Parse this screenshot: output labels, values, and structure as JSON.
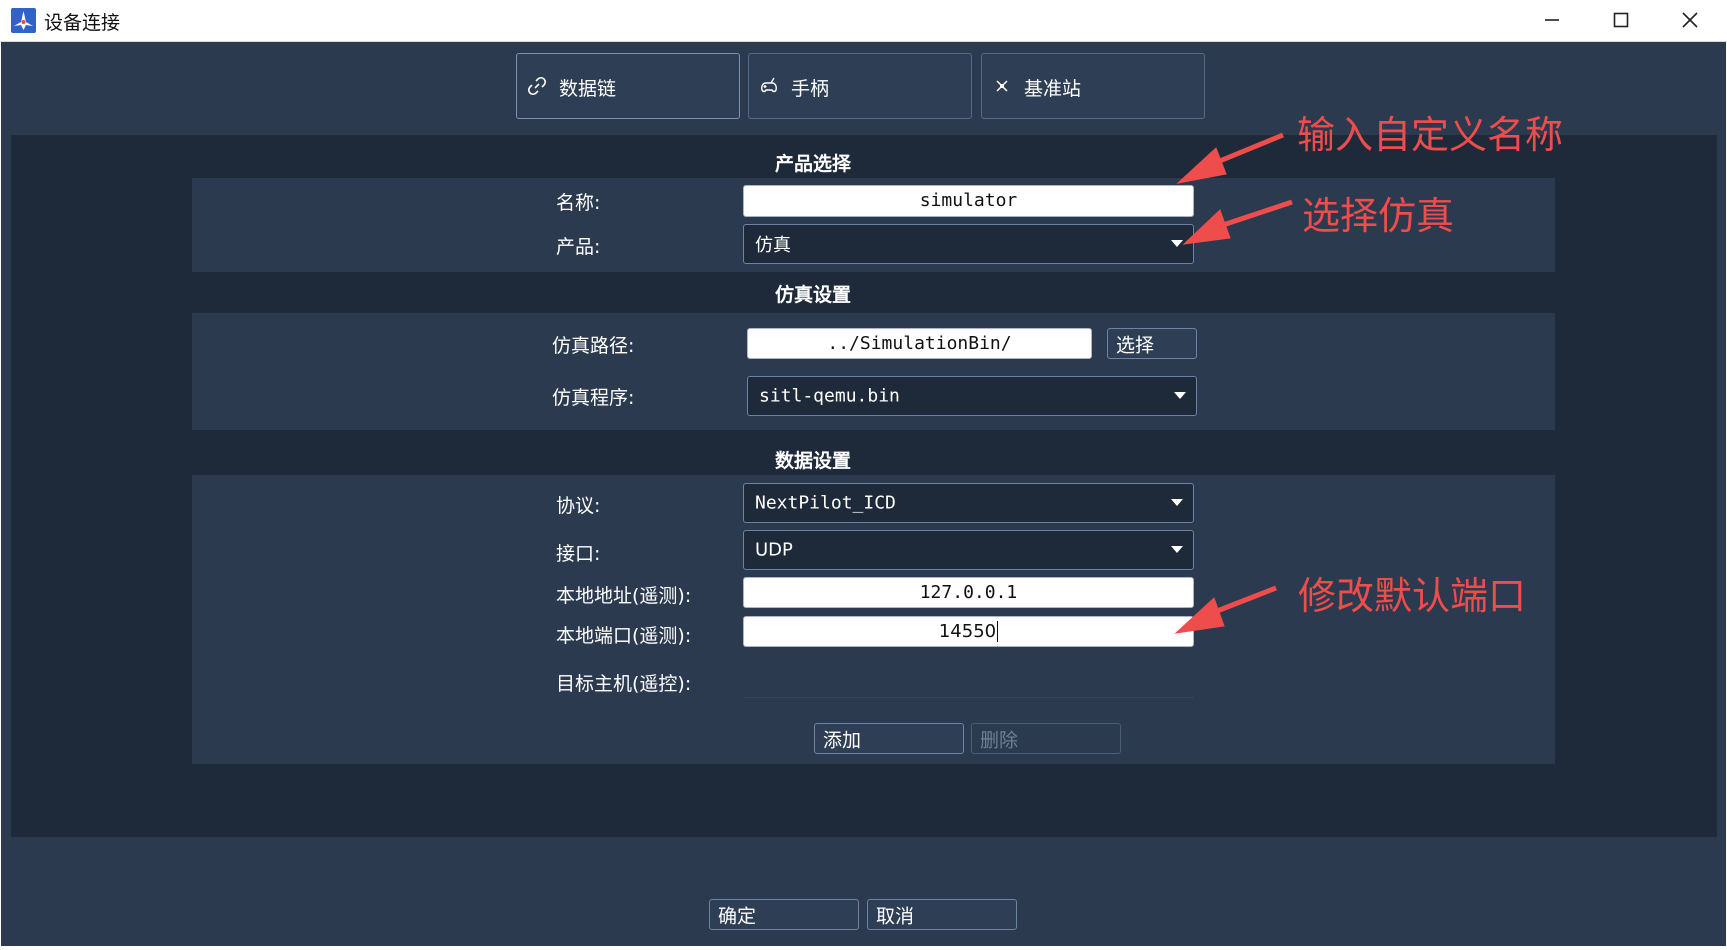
{
  "window": {
    "title": "设备连接"
  },
  "tabs": [
    {
      "label": "数据链",
      "icon": "link-icon"
    },
    {
      "label": "手柄",
      "icon": "gamepad-icon"
    },
    {
      "label": "基准站",
      "icon": "antenna-icon"
    }
  ],
  "product_section": {
    "title": "产品选择",
    "name_label": "名称:",
    "name_value": "simulator",
    "product_label": "产品:",
    "product_value": "仿真"
  },
  "sim_section": {
    "title": "仿真设置",
    "path_label": "仿真路径:",
    "path_value": "../SimulationBin/",
    "select_button": "选择",
    "program_label": "仿真程序:",
    "program_value": "sitl-qemu.bin"
  },
  "data_section": {
    "title": "数据设置",
    "protocol_label": "协议:",
    "protocol_value": "NextPilot_ICD",
    "interface_label": "接口:",
    "interface_value": "UDP",
    "local_addr_label": "本地地址(遥测):",
    "local_addr_value": "127.0.0.1",
    "local_port_label": "本地端口(遥测):",
    "local_port_value": "14550",
    "target_host_label": "目标主机(遥控):",
    "add_button": "添加",
    "delete_button": "删除"
  },
  "footer": {
    "ok_button": "确定",
    "cancel_button": "取消"
  },
  "annotations": {
    "custom_name": "输入自定义名称",
    "select_sim": "选择仿真",
    "modify_port": "修改默认端口",
    "color": "#ef4c4c"
  }
}
